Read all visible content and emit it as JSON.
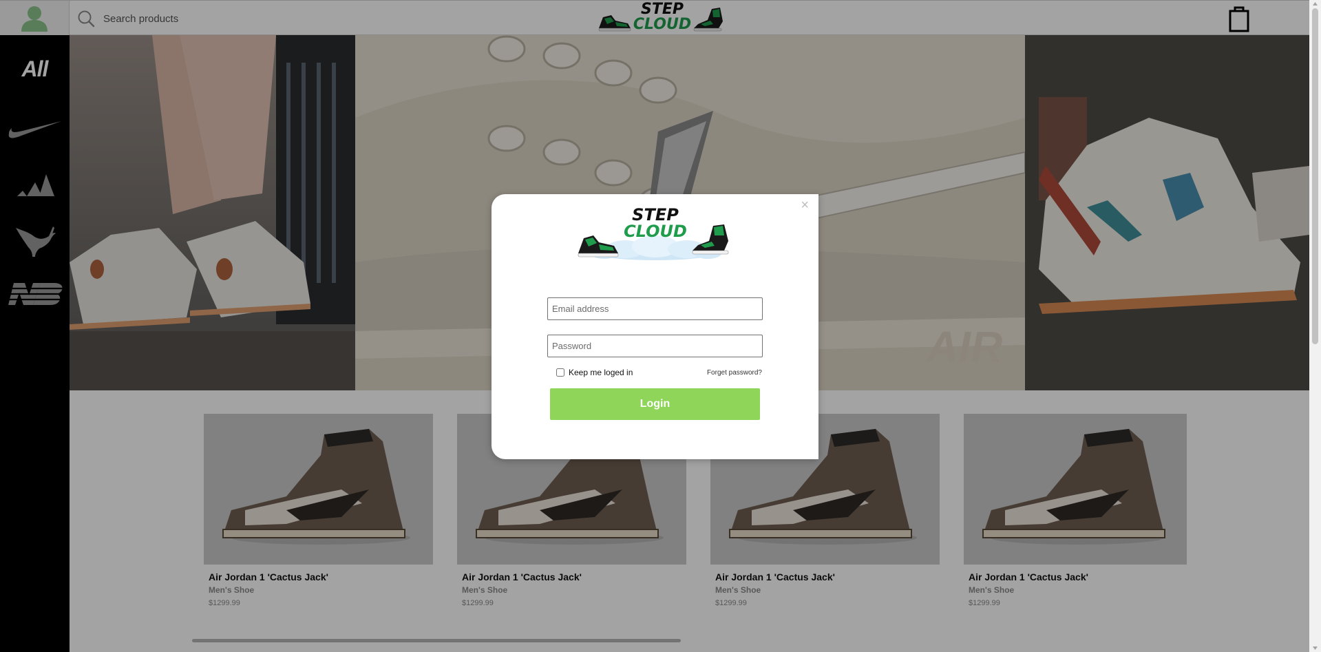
{
  "header": {
    "search": {
      "placeholder": "Search products"
    },
    "brand": {
      "line1": "STEP",
      "line2": "CLOUD"
    },
    "icons": {
      "avatar": "user-icon",
      "search": "search-icon",
      "cart": "shopping-bag-icon"
    }
  },
  "sidebar": {
    "items": [
      {
        "label": "All",
        "icon": "all-text"
      },
      {
        "label": "",
        "icon": "nike-swoosh-icon"
      },
      {
        "label": "",
        "icon": "adidas-stripes-icon"
      },
      {
        "label": "",
        "icon": "puma-cat-icon"
      },
      {
        "label": "",
        "icon": "new-balance-icon"
      }
    ]
  },
  "products": [
    {
      "name": "Air Jordan 1 'Cactus Jack'",
      "category": "Men's Shoe",
      "price": "$1299.99"
    },
    {
      "name": "Air Jordan 1 'Cactus Jack'",
      "category": "Men's Shoe",
      "price": "$1299.99"
    },
    {
      "name": "Air Jordan 1 'Cactus Jack'",
      "category": "Men's Shoe",
      "price": "$1299.99"
    },
    {
      "name": "Air Jordan 1 'Cactus Jack'",
      "category": "Men's Shoe",
      "price": "$1299.99"
    }
  ],
  "modal": {
    "close_label": "×",
    "logo": {
      "line1": "STEP",
      "line2": "CLOUD"
    },
    "email_placeholder": "Email address",
    "password_placeholder": "Password",
    "remember_label": "Keep me loged in",
    "forgot_label": "Forget password?",
    "login_label": "Login"
  },
  "colors": {
    "brand_green": "#1f9d4c",
    "login_button": "#8ed55a",
    "sidebar_bg": "#000000",
    "avatar_green": "#8bc48a"
  }
}
